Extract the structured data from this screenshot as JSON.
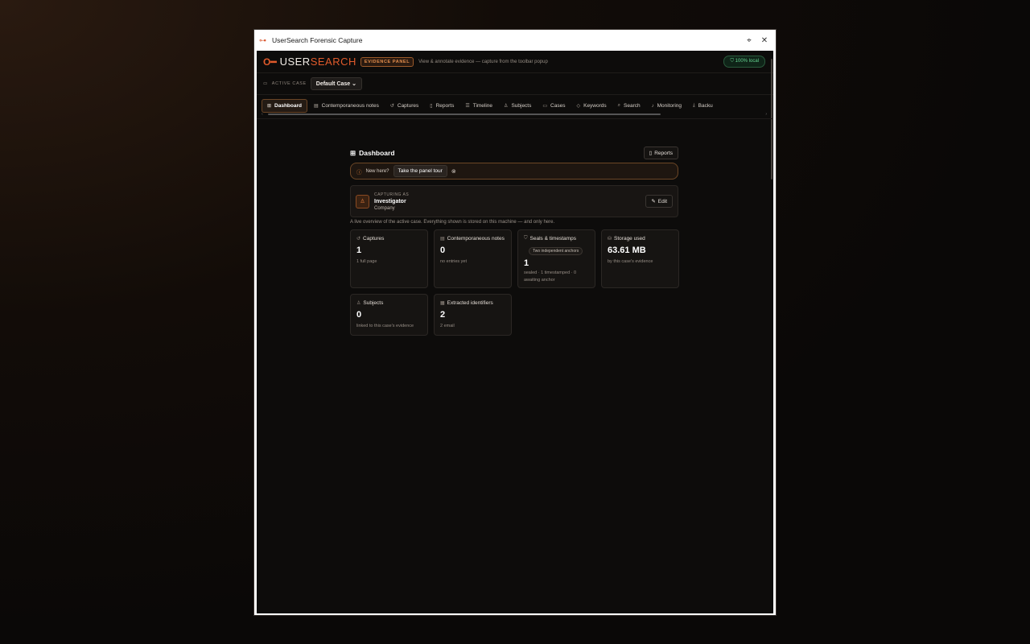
{
  "window": {
    "title": "UserSearch Forensic Capture"
  },
  "header": {
    "logo_prefix": "USER",
    "logo_accent": "SEARCH",
    "badge": "EVIDENCE PANEL",
    "subtitle": "View & annotate evidence — capture from the toolbar popup",
    "local_badge": "100% local"
  },
  "case_bar": {
    "label": "ACTIVE CASE",
    "case_name": "Default Case"
  },
  "tabs": [
    {
      "label": "Dashboard",
      "icon": "grid-icon"
    },
    {
      "label": "Contemporaneous notes",
      "icon": "notes-icon"
    },
    {
      "label": "Captures",
      "icon": "history-icon"
    },
    {
      "label": "Reports",
      "icon": "document-icon"
    },
    {
      "label": "Timeline",
      "icon": "timeline-icon"
    },
    {
      "label": "Subjects",
      "icon": "person-icon"
    },
    {
      "label": "Cases",
      "icon": "folder-icon"
    },
    {
      "label": "Keywords",
      "icon": "tag-icon"
    },
    {
      "label": "Search",
      "icon": "search-icon"
    },
    {
      "label": "Monitoring",
      "icon": "bell-icon"
    },
    {
      "label": "Backu",
      "icon": "download-icon"
    }
  ],
  "dashboard": {
    "title": "Dashboard",
    "reports_button": "Reports",
    "tour": {
      "text": "New here?",
      "button": "Take the panel tour"
    },
    "capturing": {
      "label": "CAPTURING AS",
      "name": "Investigator",
      "company": "Company",
      "edit": "Edit"
    },
    "overview": "A live overview of the active case. Everything shown is stored on this machine — and only here.",
    "stats": [
      {
        "title": "Captures",
        "value": "1",
        "sub": "1 full page",
        "icon": "history-icon"
      },
      {
        "title": "Contemporaneous notes",
        "value": "0",
        "sub": "no entries yet",
        "icon": "notes-icon"
      },
      {
        "title": "Seals & timestamps",
        "pill": "Two independent anchors",
        "value": "1",
        "sub": "sealed · 1 timestamped · 0 awaiting anchor",
        "icon": "shield-icon"
      },
      {
        "title": "Storage used",
        "value": "63.61 MB",
        "sub": "by this case's evidence",
        "icon": "database-icon"
      },
      {
        "title": "Subjects",
        "value": "0",
        "sub": "linked to this case's evidence",
        "icon": "person-icon"
      },
      {
        "title": "Extracted identifiers",
        "value": "2",
        "sub": "2 email",
        "icon": "id-card-icon"
      }
    ]
  },
  "colors": {
    "accent": "#e05a2b",
    "local_green": "#66d391",
    "background": "#0d0c0b"
  }
}
